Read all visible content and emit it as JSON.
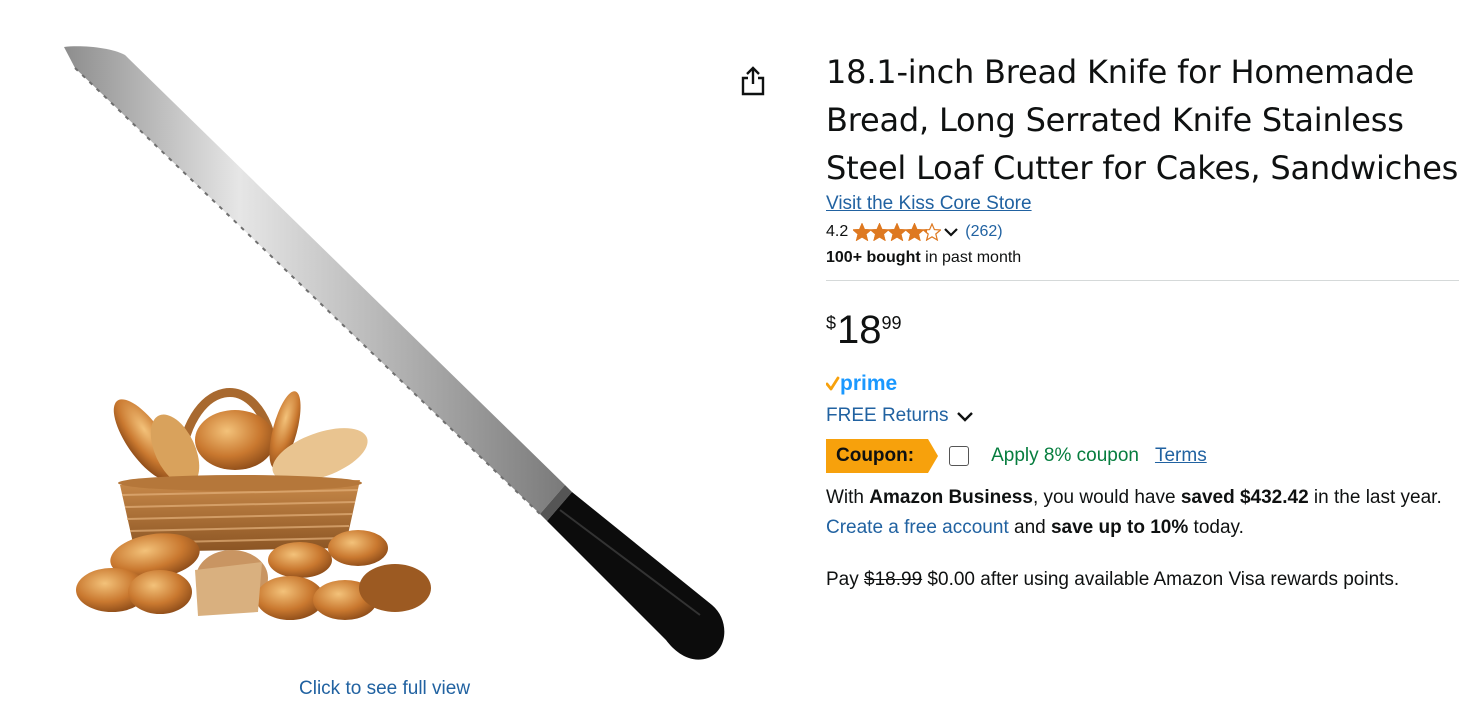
{
  "product": {
    "title": "18.1-inch Bread Knife for Homemade Bread, Long Serrated Knife Stainless Steel Loaf Cutter for Cakes, Sandwiches",
    "store_link": "Visit the Kiss Core Store",
    "rating": {
      "value": "4.2",
      "stars_out_of_5": 4.2,
      "review_count": "(262)"
    },
    "bought": {
      "bold": "100+ bought",
      "rest": " in past month"
    }
  },
  "price": {
    "symbol": "$",
    "whole": "18",
    "fraction": "99"
  },
  "prime": {
    "label": "prime",
    "check_color": "#f7a10c",
    "text_color": "#1a98ff"
  },
  "returns": {
    "label": "FREE Returns"
  },
  "coupon": {
    "badge": "Coupon:",
    "apply_text": "Apply 8% coupon",
    "terms": "Terms",
    "checked": false
  },
  "business": {
    "t1": "With ",
    "t2": "Amazon Business",
    "t3": ", you would have ",
    "t4": "saved $432.42",
    "t5": " in the last year. ",
    "link": "Create a free account",
    "t6": " and ",
    "t7": "save up to 10%",
    "t8": " today."
  },
  "pay": {
    "t1": "Pay ",
    "old_price": "$18.99",
    "t2": " $0.00 after using available Amazon Visa rewards points."
  },
  "media": {
    "full_view_link": "Click to see full view",
    "share_icon": "share-icon"
  },
  "colors": {
    "link": "#2162a1",
    "star": "#de7921",
    "coupon_badge": "#f7a10c",
    "coupon_text": "#067d3e"
  }
}
